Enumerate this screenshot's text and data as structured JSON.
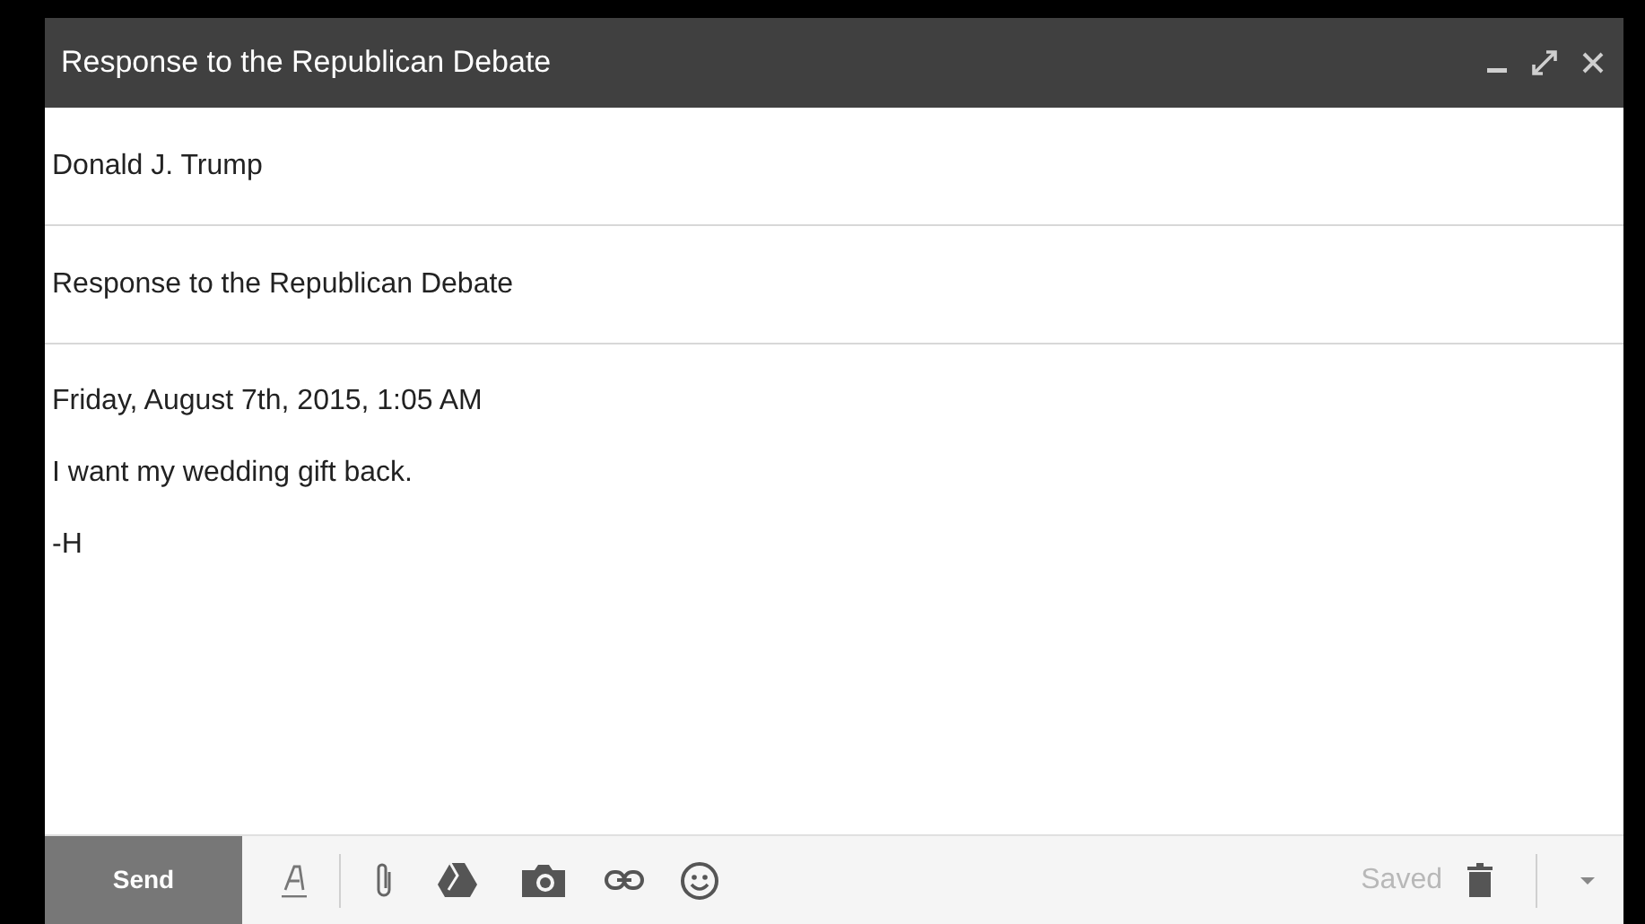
{
  "window": {
    "title": "Response to the Republican Debate"
  },
  "to": {
    "value": "Donald J. Trump"
  },
  "subject": {
    "value": "Response to the Republican Debate"
  },
  "body": [
    "Friday, August 7th, 2015, 1:05 AM",
    "I want my wedding gift back.",
    "-H"
  ],
  "toolbar": {
    "send": "Send",
    "status": "Saved"
  }
}
